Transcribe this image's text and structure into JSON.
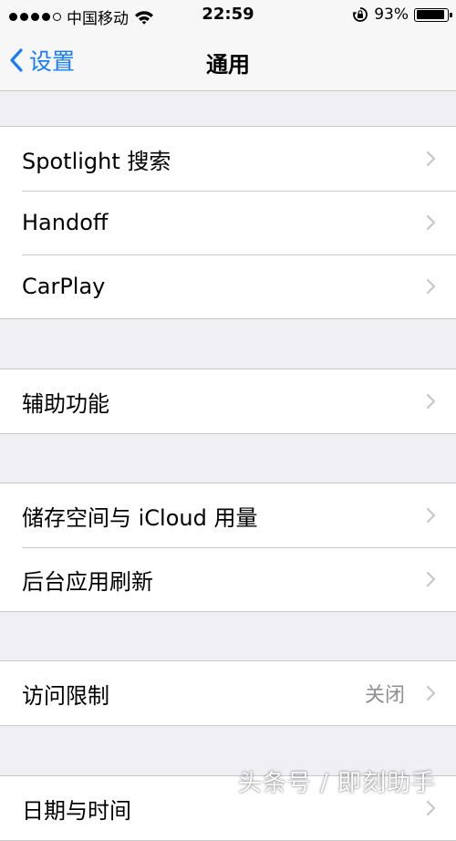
{
  "status_bar": {
    "carrier": "中国移动",
    "time": "22:59",
    "battery_percent": "93%",
    "battery_level": 0.93,
    "signal_dots_filled": 4,
    "signal_dots_total": 5,
    "icons": [
      "wifi-icon",
      "rotation-lock-icon",
      "battery-icon"
    ]
  },
  "nav": {
    "back_label": "设置",
    "title": "通用",
    "accent_color": "#1a7cf5"
  },
  "groups": [
    {
      "items": [
        {
          "label": "Spotlight 搜索"
        },
        {
          "label": "Handoff"
        },
        {
          "label": "CarPlay"
        }
      ]
    },
    {
      "items": [
        {
          "label": "辅助功能"
        }
      ]
    },
    {
      "items": [
        {
          "label": "储存空间与 iCloud 用量"
        },
        {
          "label": "后台应用刷新"
        }
      ]
    },
    {
      "items": [
        {
          "label": "访问限制",
          "value": "关闭"
        }
      ]
    },
    {
      "items": [
        {
          "label": "日期与时间"
        }
      ]
    }
  ],
  "watermark": "头条号 / 即刻助手"
}
